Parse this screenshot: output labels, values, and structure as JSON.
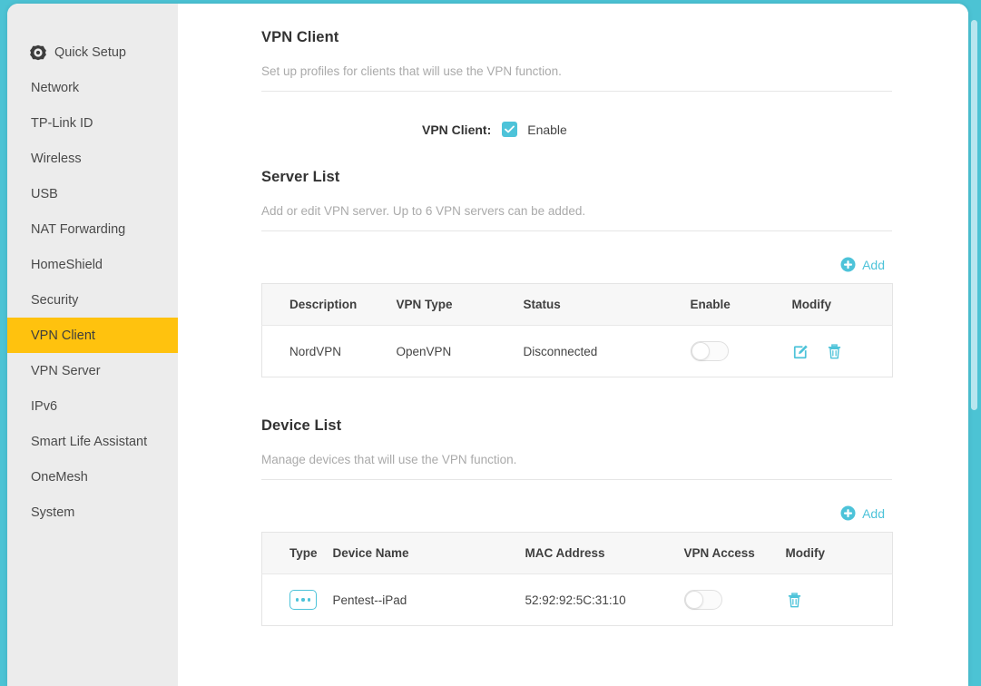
{
  "theme": {
    "accent": "#4dc3d9",
    "active_nav_bg": "#ffc20e",
    "sidebar_bg": "#ececec",
    "page_bg": "#4cc3d4"
  },
  "sidebar": {
    "items": [
      {
        "label": "Quick Setup",
        "icon": "gear-icon",
        "active": false
      },
      {
        "label": "Network",
        "icon": "",
        "active": false
      },
      {
        "label": "TP-Link ID",
        "icon": "",
        "active": false
      },
      {
        "label": "Wireless",
        "icon": "",
        "active": false
      },
      {
        "label": "USB",
        "icon": "",
        "active": false
      },
      {
        "label": "NAT Forwarding",
        "icon": "",
        "active": false
      },
      {
        "label": "HomeShield",
        "icon": "",
        "active": false
      },
      {
        "label": "Security",
        "icon": "",
        "active": false
      },
      {
        "label": "VPN Client",
        "icon": "",
        "active": true
      },
      {
        "label": "VPN Server",
        "icon": "",
        "active": false
      },
      {
        "label": "IPv6",
        "icon": "",
        "active": false
      },
      {
        "label": "Smart Life Assistant",
        "icon": "",
        "active": false
      },
      {
        "label": "OneMesh",
        "icon": "",
        "active": false
      },
      {
        "label": "System",
        "icon": "",
        "active": false
      }
    ]
  },
  "vpn_client": {
    "title": "VPN Client",
    "description": "Set up profiles for clients that will use the VPN function.",
    "field_label": "VPN Client:",
    "checkbox_label": "Enable",
    "checkbox_checked": true
  },
  "server_list": {
    "title": "Server List",
    "description": "Add or edit VPN server. Up to 6 VPN servers can be added.",
    "add_label": "Add",
    "columns": [
      "Description",
      "VPN Type",
      "Status",
      "Enable",
      "Modify"
    ],
    "rows": [
      {
        "description": "NordVPN",
        "vpn_type": "OpenVPN",
        "status": "Disconnected",
        "enabled": false,
        "modify_icons": [
          "edit-icon",
          "delete-icon"
        ]
      }
    ]
  },
  "device_list": {
    "title": "Device List",
    "description": "Manage devices that will use the VPN function.",
    "add_label": "Add",
    "columns": [
      "Type",
      "Device Name",
      "MAC Address",
      "VPN Access",
      "Modify"
    ],
    "rows": [
      {
        "type_icon": "device-dots-icon",
        "device_name": "Pentest--iPad",
        "mac_address": "52:92:92:5C:31:10",
        "vpn_access": false,
        "modify_icons": [
          "delete-icon"
        ]
      }
    ]
  }
}
